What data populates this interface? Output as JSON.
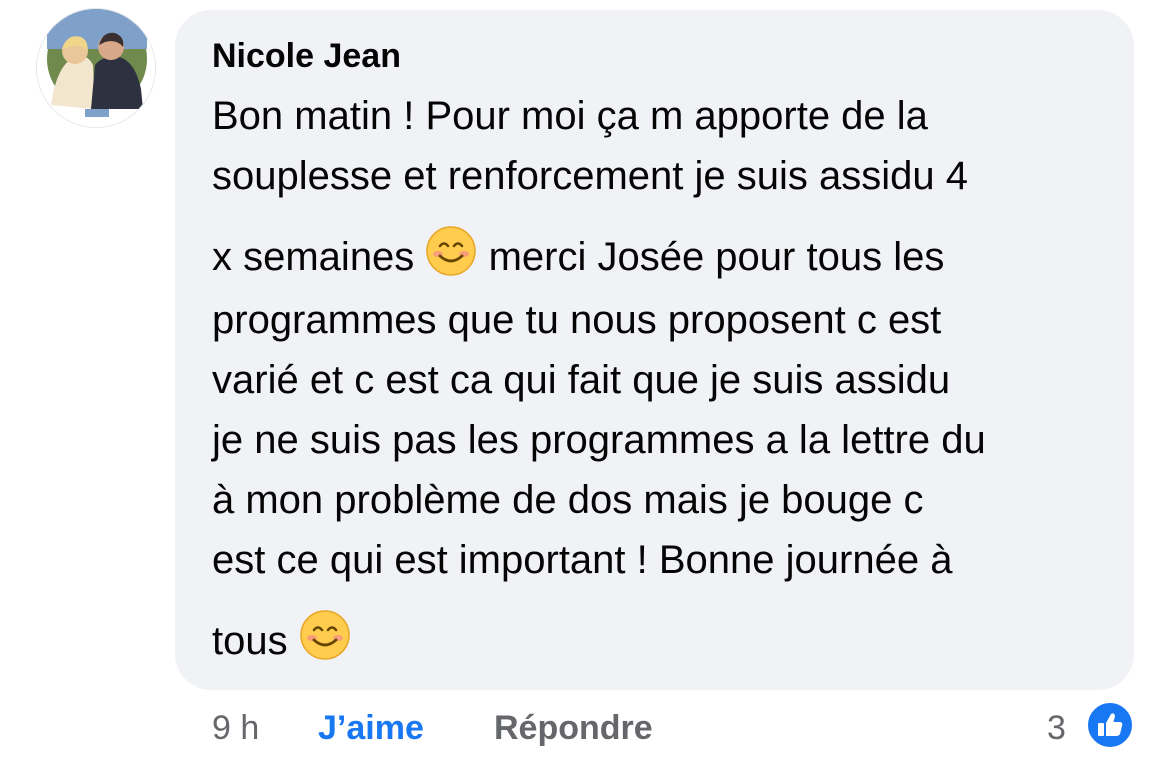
{
  "comment": {
    "author": "Nicole Jean",
    "lines": [
      "Bon matin ! Pour moi ça m apporte de la",
      "souplesse et renforcement je suis assidu 4",
      "x semaines",
      "merci Josée pour tous les",
      "programmes que tu nous proposent c est",
      "varié et c est ca qui fait que je suis assidu",
      "je ne suis pas les programmes a la lettre du",
      "à mon problème de dos mais je bouge c",
      "est ce qui est important ! Bonne journée à",
      "tous"
    ],
    "emoji": "smiling-face-with-smiling-eyes-emoji"
  },
  "footer": {
    "time": "9 h",
    "like_label": "J’aime",
    "reply_label": "Répondre",
    "reaction_count": "3",
    "reaction_icon": "thumbs-up-icon"
  },
  "colors": {
    "bubble": "#f0f2f5",
    "accent": "#1877f2",
    "muted": "#65676b"
  }
}
